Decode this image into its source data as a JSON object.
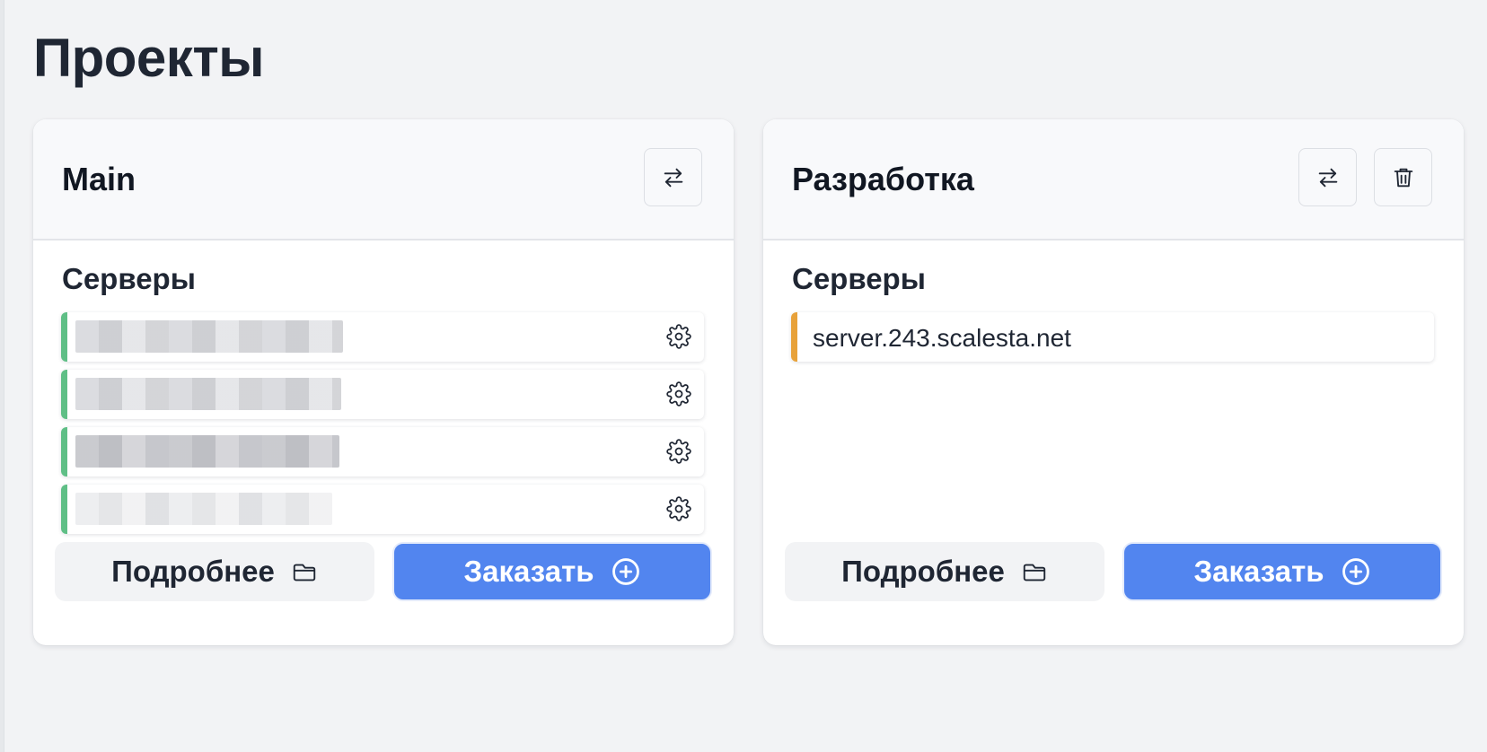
{
  "page": {
    "title": "Проекты"
  },
  "projects": [
    {
      "title": "Main",
      "section_label": "Серверы",
      "servers": [
        {
          "name": "",
          "status_color": "#5fbf86",
          "redacted": true
        },
        {
          "name": "",
          "status_color": "#5fbf86",
          "redacted": true
        },
        {
          "name": "",
          "status_color": "#5fbf86",
          "redacted": true
        },
        {
          "name": "",
          "status_color": "#5fbf86",
          "redacted": true
        }
      ],
      "buttons": {
        "more_label": "Подробнее",
        "order_label": "Заказать"
      },
      "header_actions": [
        "swap-icon"
      ]
    },
    {
      "title": "Разработка",
      "section_label": "Серверы",
      "servers": [
        {
          "name": "server.243.scalesta.net",
          "status_color": "#e8a23a",
          "redacted": false
        }
      ],
      "buttons": {
        "more_label": "Подробнее",
        "order_label": "Заказать"
      },
      "header_actions": [
        "swap-icon",
        "trash-icon"
      ]
    }
  ],
  "colors": {
    "accent": "#5285ef",
    "status_ok": "#5fbf86",
    "status_pending": "#e8a23a",
    "background": "#f2f3f5"
  }
}
